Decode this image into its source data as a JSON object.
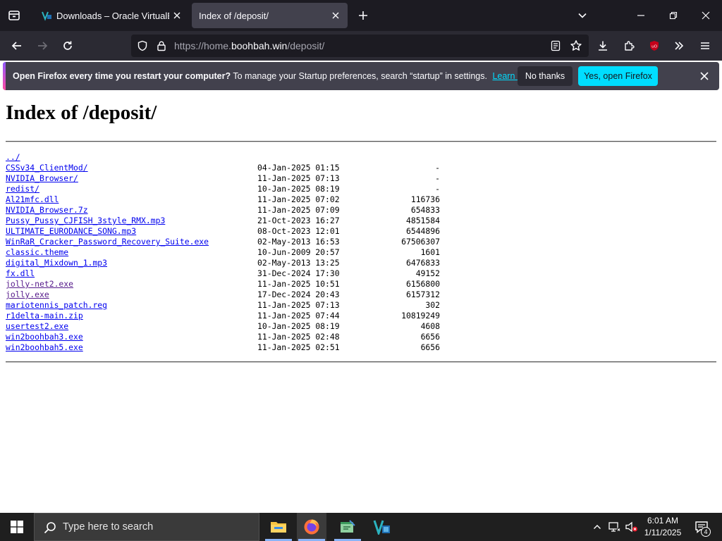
{
  "tabs": [
    {
      "title": "Downloads – Oracle VirtualBox",
      "favicon": "virtualbox-icon",
      "active": false
    },
    {
      "title": "Index of /deposit/",
      "favicon": "none",
      "active": true
    }
  ],
  "urlbar": {
    "prefix": "https://home.",
    "domain": "boohbah.win",
    "path": "/deposit/"
  },
  "notification": {
    "bold": "Open Firefox every time you restart your computer?",
    "text": " To manage your Startup preferences, search “startup” in settings.",
    "learn_more": "Learn more",
    "no_thanks": "No thanks",
    "yes": "Yes, open Firefox"
  },
  "page": {
    "heading": "Index of /deposit/",
    "parent_link": "../",
    "entries": [
      {
        "name": "CSSv34_ClientMod/",
        "date": "04-Jan-2025 01:15",
        "size": "-"
      },
      {
        "name": "NVIDIA_Browser/",
        "date": "11-Jan-2025 07:13",
        "size": "-"
      },
      {
        "name": "redist/",
        "date": "10-Jan-2025 08:19",
        "size": "-"
      },
      {
        "name": "Al21mfc.dll",
        "date": "11-Jan-2025 07:02",
        "size": "116736"
      },
      {
        "name": "NVIDIA_Browser.7z",
        "date": "11-Jan-2025 07:09",
        "size": "654833"
      },
      {
        "name": "Pussy_Pussy_CJFISH_3style_RMX.mp3",
        "date": "21-Oct-2023 16:27",
        "size": "4851584"
      },
      {
        "name": "ULTIMATE_EURODANCE_SONG.mp3",
        "date": "08-Oct-2023 12:01",
        "size": "6544896"
      },
      {
        "name": "WinRaR_Cracker_Password_Recovery_Suite.exe",
        "date": "02-May-2013 16:53",
        "size": "67506307"
      },
      {
        "name": "classic.theme",
        "date": "10-Jun-2009 20:57",
        "size": "1601"
      },
      {
        "name": "digital_Mixdown_1.mp3",
        "date": "02-May-2013 13:25",
        "size": "6476833"
      },
      {
        "name": "fx.dll",
        "date": "31-Dec-2024 17:30",
        "size": "49152"
      },
      {
        "name": "jolly-net2.exe",
        "date": "11-Jan-2025 10:51",
        "size": "6156800"
      },
      {
        "name": "jolly.exe",
        "date": "17-Dec-2024 20:43",
        "size": "6157312"
      },
      {
        "name": "mariotennis_patch.reg",
        "date": "11-Jan-2025 07:13",
        "size": "302"
      },
      {
        "name": "r1delta-main.zip",
        "date": "11-Jan-2025 07:44",
        "size": "10819249"
      },
      {
        "name": "usertest2.exe",
        "date": "10-Jan-2025 08:19",
        "size": "4608"
      },
      {
        "name": "win2boohbah3.exe",
        "date": "11-Jan-2025 02:48",
        "size": "6656"
      },
      {
        "name": "win2boohbah5.exe",
        "date": "11-Jan-2025 02:51",
        "size": "6656"
      }
    ]
  },
  "taskbar": {
    "search_placeholder": "Type here to search",
    "apps": [
      "file-explorer-icon",
      "firefox-icon",
      "text-editor-icon",
      "virtualbox-icon"
    ],
    "time": "6:01 AM",
    "date": "1/11/2025",
    "notification_count": "4"
  },
  "colors": {
    "tabbar_bg": "#1c1b22",
    "navbar_bg": "#2b2a33",
    "accent_cyan": "#00ddff",
    "link": "#0000ee",
    "link_visited": "#551a8b"
  }
}
